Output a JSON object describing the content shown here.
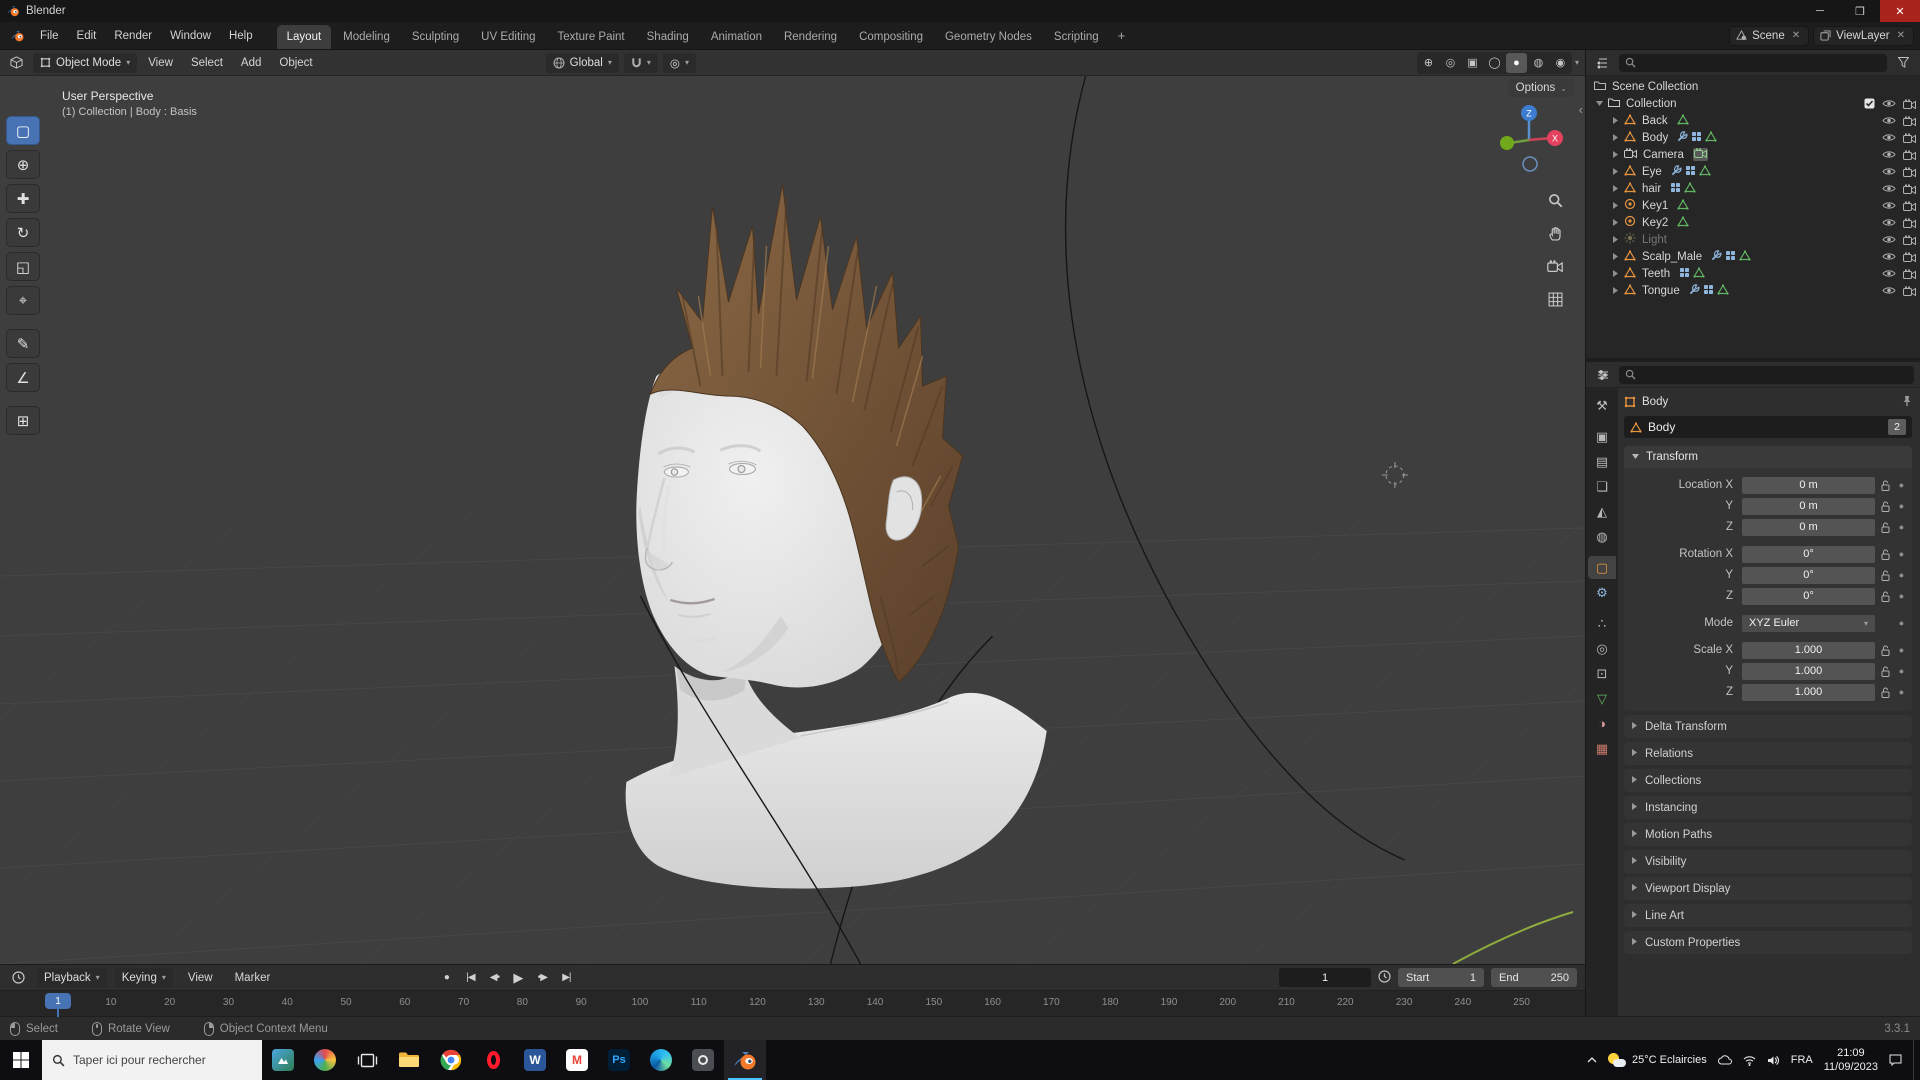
{
  "titlebar": {
    "app_title": "Blender"
  },
  "menubar": {
    "menus": [
      "File",
      "Edit",
      "Render",
      "Window",
      "Help"
    ],
    "workspaces": [
      "Layout",
      "Modeling",
      "Sculpting",
      "UV Editing",
      "Texture Paint",
      "Shading",
      "Animation",
      "Rendering",
      "Compositing",
      "Geometry Nodes",
      "Scripting"
    ],
    "active_workspace": "Layout",
    "new_workspace_button": "+",
    "scene_label": "Scene",
    "viewlayer_label": "ViewLayer"
  },
  "viewport_header": {
    "mode": "Object Mode",
    "menus": [
      "View",
      "Select",
      "Add",
      "Object"
    ],
    "orientation": "Global",
    "options_label": "Options",
    "right_icons": [
      "show-gizmo",
      "show-overlays",
      "toggle-xray",
      "shading-wireframe",
      "shading-solid",
      "shading-material",
      "shading-rendered"
    ],
    "active_shading": "shading-solid"
  },
  "viewport": {
    "overlay_line1": "User Perspective",
    "overlay_line2": "(1) Collection | Body : Basis",
    "gizmo_axis_x": "X",
    "gizmo_axis_z": "Z",
    "tools": [
      "select-box",
      "cursor",
      "move",
      "rotate",
      "scale",
      "transform",
      "annotate",
      "measure",
      "add-cube"
    ]
  },
  "outliner": {
    "scene_collection": "Scene Collection",
    "collection": "Collection",
    "items": [
      {
        "name": "Back",
        "type": "mesh",
        "extras": [
          "data"
        ],
        "dimmed": false
      },
      {
        "name": "Body",
        "type": "mesh",
        "extras": [
          "modifier",
          "grid",
          "data"
        ],
        "dimmed": false
      },
      {
        "name": "Camera",
        "type": "camera",
        "extras": [
          "camera-data"
        ],
        "dimmed": false
      },
      {
        "name": "Eye",
        "type": "mesh",
        "extras": [
          "modifier",
          "grid",
          "data"
        ],
        "dimmed": false
      },
      {
        "name": "hair",
        "type": "mesh",
        "extras": [
          "grid",
          "data"
        ],
        "dimmed": false
      },
      {
        "name": "Key1",
        "type": "shapekey",
        "extras": [
          "data"
        ],
        "dimmed": false
      },
      {
        "name": "Key2",
        "type": "shapekey",
        "extras": [
          "data"
        ],
        "dimmed": false
      },
      {
        "name": "Light",
        "type": "light",
        "extras": [],
        "dimmed": true
      },
      {
        "name": "Scalp_Male",
        "type": "mesh",
        "extras": [
          "modifier",
          "grid",
          "data"
        ],
        "dimmed": false
      },
      {
        "name": "Teeth",
        "type": "mesh",
        "extras": [
          "grid",
          "data"
        ],
        "dimmed": false
      },
      {
        "name": "Tongue",
        "type": "mesh",
        "extras": [
          "modifier",
          "grid",
          "data"
        ],
        "dimmed": false
      }
    ]
  },
  "properties": {
    "breadcrumb_object": "Body",
    "name_field": "Body",
    "name_badge": "2",
    "tabs": [
      "tool",
      "render",
      "output",
      "view-layer",
      "scene",
      "world",
      "object",
      "modifiers",
      "particles",
      "physics",
      "constraints",
      "object-data",
      "material",
      "texture"
    ],
    "active_tab": "object",
    "transform": {
      "title": "Transform",
      "rows": [
        {
          "label": "Location X",
          "value": "0 m",
          "dropdown": false
        },
        {
          "label": "Y",
          "value": "0 m",
          "dropdown": false
        },
        {
          "label": "Z",
          "value": "0 m",
          "dropdown": false
        },
        {
          "label": "Rotation X",
          "value": "0°",
          "dropdown": false
        },
        {
          "label": "Y",
          "value": "0°",
          "dropdown": false
        },
        {
          "label": "Z",
          "value": "0°",
          "dropdown": false
        },
        {
          "label": "Mode",
          "value": "XYZ Euler",
          "dropdown": true
        },
        {
          "label": "Scale X",
          "value": "1.000",
          "dropdown": false
        },
        {
          "label": "Y",
          "value": "1.000",
          "dropdown": false
        },
        {
          "label": "Z",
          "value": "1.000",
          "dropdown": false
        }
      ]
    },
    "sections": [
      "Delta Transform",
      "Relations",
      "Collections",
      "Instancing",
      "Motion Paths",
      "Visibility",
      "Viewport Display",
      "Line Art",
      "Custom Properties"
    ]
  },
  "timeline": {
    "menus_dropdown": [
      "Playback",
      "Keying"
    ],
    "menus_plain": [
      "View",
      "Marker"
    ],
    "transport": [
      "jump-start",
      "prev-keyframe",
      "play",
      "next-keyframe",
      "jump-end"
    ],
    "current_frame": "1",
    "start_label": "Start",
    "start": "1",
    "end_label": "End",
    "end": "250",
    "ticks": [
      "1",
      "10",
      "20",
      "30",
      "40",
      "50",
      "60",
      "70",
      "80",
      "90",
      "100",
      "110",
      "120",
      "130",
      "140",
      "150",
      "160",
      "170",
      "180",
      "190",
      "200",
      "210",
      "220",
      "230",
      "240",
      "250"
    ]
  },
  "statusbar": {
    "hints": [
      {
        "button": "left",
        "label": "Select"
      },
      {
        "button": "middle",
        "label": "Rotate View"
      },
      {
        "button": "right",
        "label": "Object Context Menu"
      }
    ],
    "version": "3.3.1"
  },
  "taskbar": {
    "search_placeholder": "Taper ici pour rechercher",
    "apps": [
      "start",
      "search",
      "pinned-1",
      "pinned-2",
      "task-view",
      "file-explorer",
      "chrome",
      "opera",
      "word",
      "gmail",
      "photoshop",
      "edge",
      "snipping-tool",
      "blender"
    ],
    "active_app": "blender",
    "tray": {
      "weather_temp": "25°C",
      "weather_desc": "Eclaircies",
      "language": "FRA",
      "time": "21:09",
      "date": "11/09/2023"
    }
  },
  "colors": {
    "accent": "#4772b3",
    "mesh_orange": "#e8953e",
    "data_green": "#62b562",
    "modifier_blue": "#8fb6dd"
  }
}
